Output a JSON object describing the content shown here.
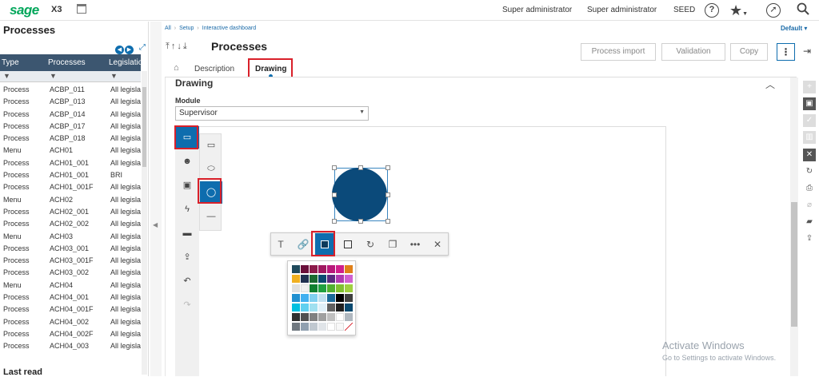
{
  "topbar": {
    "logo": "sage",
    "app": "X3",
    "user1": "Super administrator",
    "user2": "Super administrator",
    "folder": "SEED",
    "help_icon": "question-circle-icon",
    "star_icon": "star-icon",
    "compass_icon": "compass-icon",
    "search_icon": "search-icon"
  },
  "left": {
    "title": "Processes",
    "columns": [
      "Type",
      "Processes",
      "Legislation"
    ],
    "rows": [
      [
        "Process",
        "ACBP_011",
        "All legislat"
      ],
      [
        "Process",
        "ACBP_013",
        "All legislat"
      ],
      [
        "Process",
        "ACBP_014",
        "All legislat"
      ],
      [
        "Process",
        "ACBP_017",
        "All legislat"
      ],
      [
        "Process",
        "ACBP_018",
        "All legislat"
      ],
      [
        "Menu",
        "ACH01",
        "All legislat"
      ],
      [
        "Process",
        "ACH01_001",
        "All legislat"
      ],
      [
        "Process",
        "ACH01_001",
        "BRI"
      ],
      [
        "Process",
        "ACH01_001F",
        "All legislat"
      ],
      [
        "Menu",
        "ACH02",
        "All legislat"
      ],
      [
        "Process",
        "ACH02_001",
        "All legislat"
      ],
      [
        "Process",
        "ACH02_002",
        "All legislat"
      ],
      [
        "Menu",
        "ACH03",
        "All legislat"
      ],
      [
        "Process",
        "ACH03_001",
        "All legislat"
      ],
      [
        "Process",
        "ACH03_001F",
        "All legislat"
      ],
      [
        "Process",
        "ACH03_002",
        "All legislat"
      ],
      [
        "Menu",
        "ACH04",
        "All legislat"
      ],
      [
        "Process",
        "ACH04_001",
        "All legislat"
      ],
      [
        "Process",
        "ACH04_001F",
        "All legislat"
      ],
      [
        "Process",
        "ACH04_002",
        "All legislat"
      ],
      [
        "Process",
        "ACH04_002F",
        "All legislat"
      ],
      [
        "Process",
        "ACH04_003",
        "All legislat"
      ]
    ],
    "last_read": "Last read"
  },
  "breadcrumb": [
    "All",
    "Setup",
    "Interactive dashboard"
  ],
  "default_label": "Default",
  "page": {
    "title": "Processes",
    "buttons": {
      "process_import": "Process import",
      "validation": "Validation",
      "copy": "Copy"
    },
    "tabs": [
      "Description",
      "Drawing"
    ],
    "active_tab": "Drawing"
  },
  "section": {
    "title": "Drawing",
    "module_label": "Module",
    "module_value": "Supervisor"
  },
  "colors": {
    "accent": "#0e6dae",
    "highlight": "#d9202a",
    "shape_fill": "#0b4a7a",
    "swatches": [
      [
        "#1f4a5c",
        "#6a0f3a",
        "#8c1a4a",
        "#a01860",
        "#b8187a",
        "#d01f8c",
        "#e0801a"
      ],
      [
        "#f0b020",
        "#203050",
        "#1a6a30",
        "#0a4a70",
        "#5a2a80",
        "#b03ab0",
        "#d060d0"
      ],
      [
        "#e0e0e0",
        "#f0f0f0",
        "#108030",
        "#20a040",
        "#50b030",
        "#80c030",
        "#a0d040"
      ],
      [
        "#2090d0",
        "#40b0f0",
        "#80d0f0",
        "#c0e0f0",
        "#1a6a9a",
        "#000000",
        "#404040"
      ],
      [
        "#00c0e0",
        "#60d0f0",
        "#a0e0f0",
        "#e0f0f8",
        "#606060",
        "#202020",
        "#0a4a70"
      ],
      [
        "#303030",
        "#505050",
        "#808080",
        "#a0a0a0",
        "#c0c0c0",
        "#ffffff",
        "#b0b8c0"
      ],
      [
        "#707880",
        "#90a0b0",
        "#c0c8d0",
        "#e0e4e8",
        "#ffffff",
        "#f8f8f8",
        "none"
      ]
    ]
  },
  "watermark": {
    "line1": "Activate Windows",
    "line2": "Go to Settings to activate Windows."
  }
}
